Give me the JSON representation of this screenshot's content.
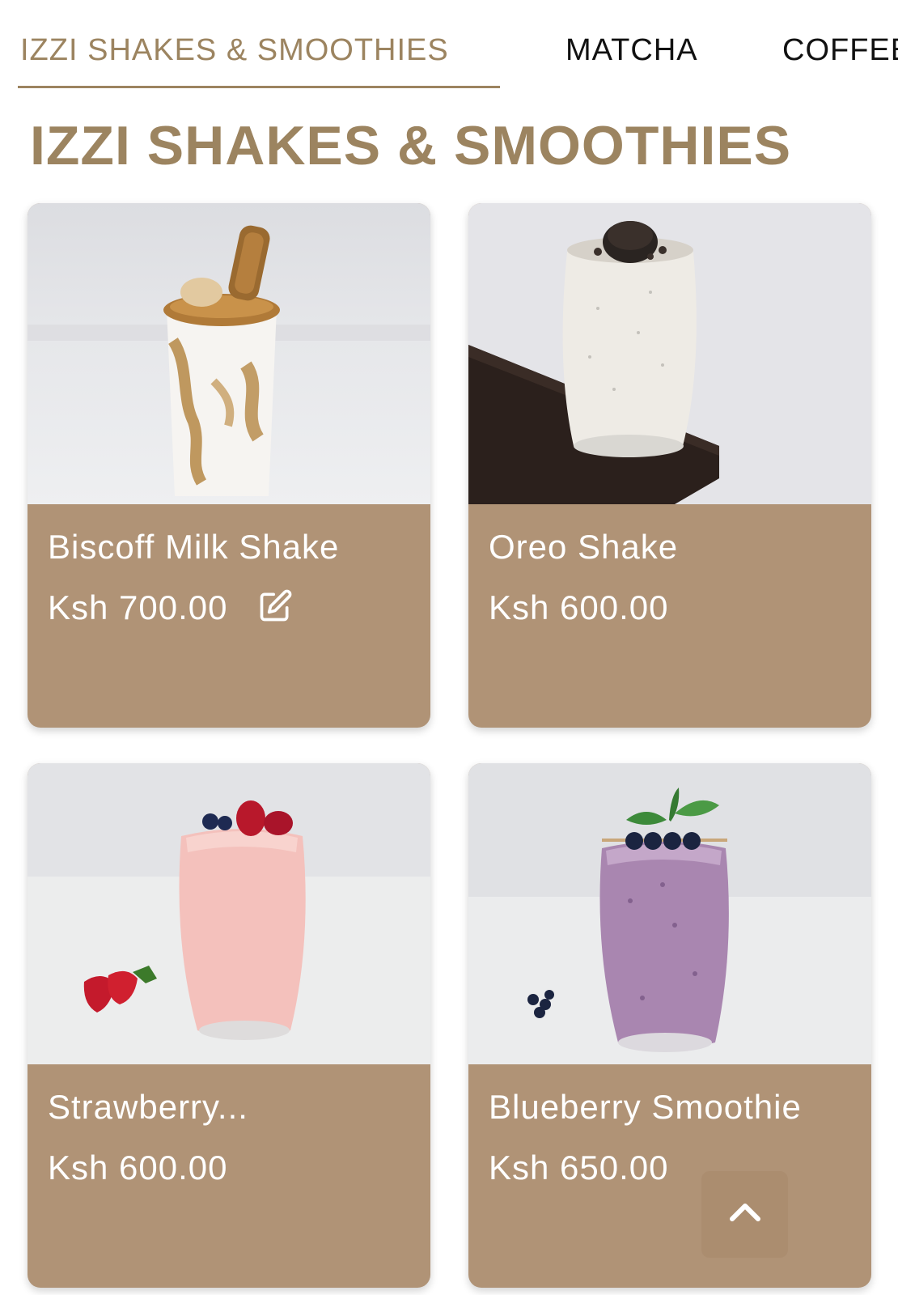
{
  "tabs": [
    {
      "label": "IZZI SHAKES & SMOOTHIES",
      "active": true
    },
    {
      "label": "MATCHA",
      "active": false
    },
    {
      "label": "COFFEE",
      "active": false
    }
  ],
  "section": {
    "title": "IZZI SHAKES & SMOOTHIES"
  },
  "products": [
    {
      "name": "Biscoff Milk Shake",
      "price": "Ksh 700.00",
      "has_edit_icon": true
    },
    {
      "name": "Oreo Shake",
      "price": "Ksh 600.00",
      "has_edit_icon": false
    },
    {
      "name": "Strawberry...",
      "price": "Ksh 600.00",
      "has_edit_icon": false
    },
    {
      "name": "Blueberry Smoothie",
      "price": "Ksh 650.00",
      "has_edit_icon": false
    }
  ],
  "icons": {
    "edit": "edit-icon",
    "back_to_top": "chevron-up-icon"
  },
  "colors": {
    "accent": "#9c8460",
    "card_footer": "#b09376",
    "back_to_top_bg": "#aa8c6e"
  }
}
